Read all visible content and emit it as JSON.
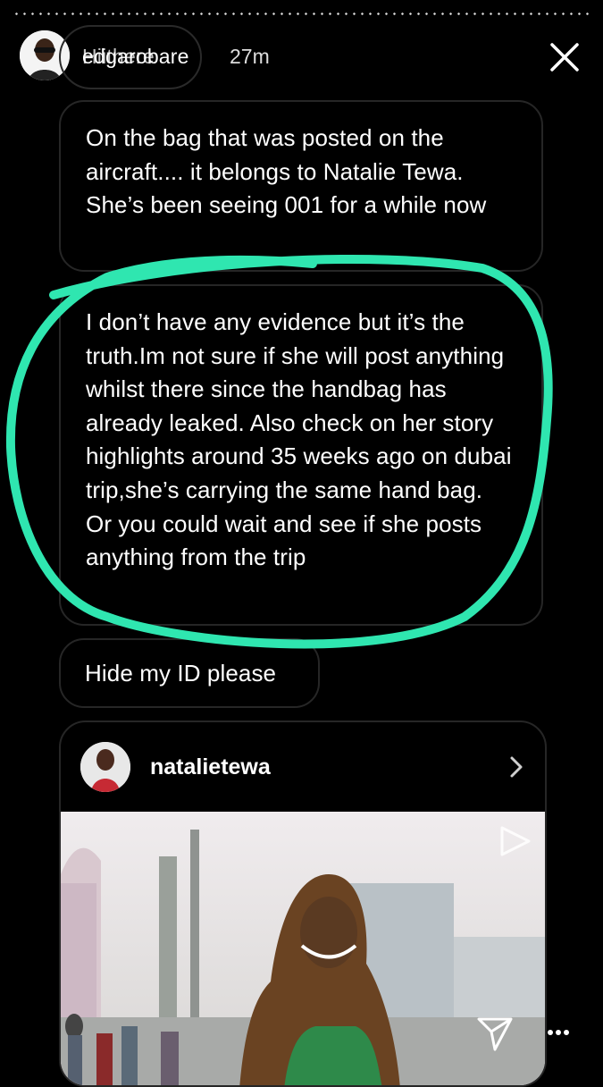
{
  "story": {
    "username": "edgarobare",
    "username_overlay": "Hiithere",
    "time": "27m",
    "accent_circle_color": "#2fe6b0"
  },
  "messages": [
    {
      "text": "On the bag that was posted on the aircraft.... it belongs to Natalie Tewa. She’s been seeing 001 for a while now"
    },
    {
      "text": "I don’t have any evidence but it’s the truth.Im not sure if she will post anything whilst there since the handbag has already leaked. Also check on her story highlights around 35 weeks ago on dubai trip,she’s carrying the same hand bag."
    },
    {
      "text": "Or you could wait and see if she posts anything from the trip"
    },
    {
      "text": "Hide my ID please"
    }
  ],
  "shared_post": {
    "username": "natalietewa",
    "icon": "chevron-right-icon"
  },
  "icons": {
    "close": "close-icon",
    "share": "send-icon",
    "more": "more-icon"
  }
}
